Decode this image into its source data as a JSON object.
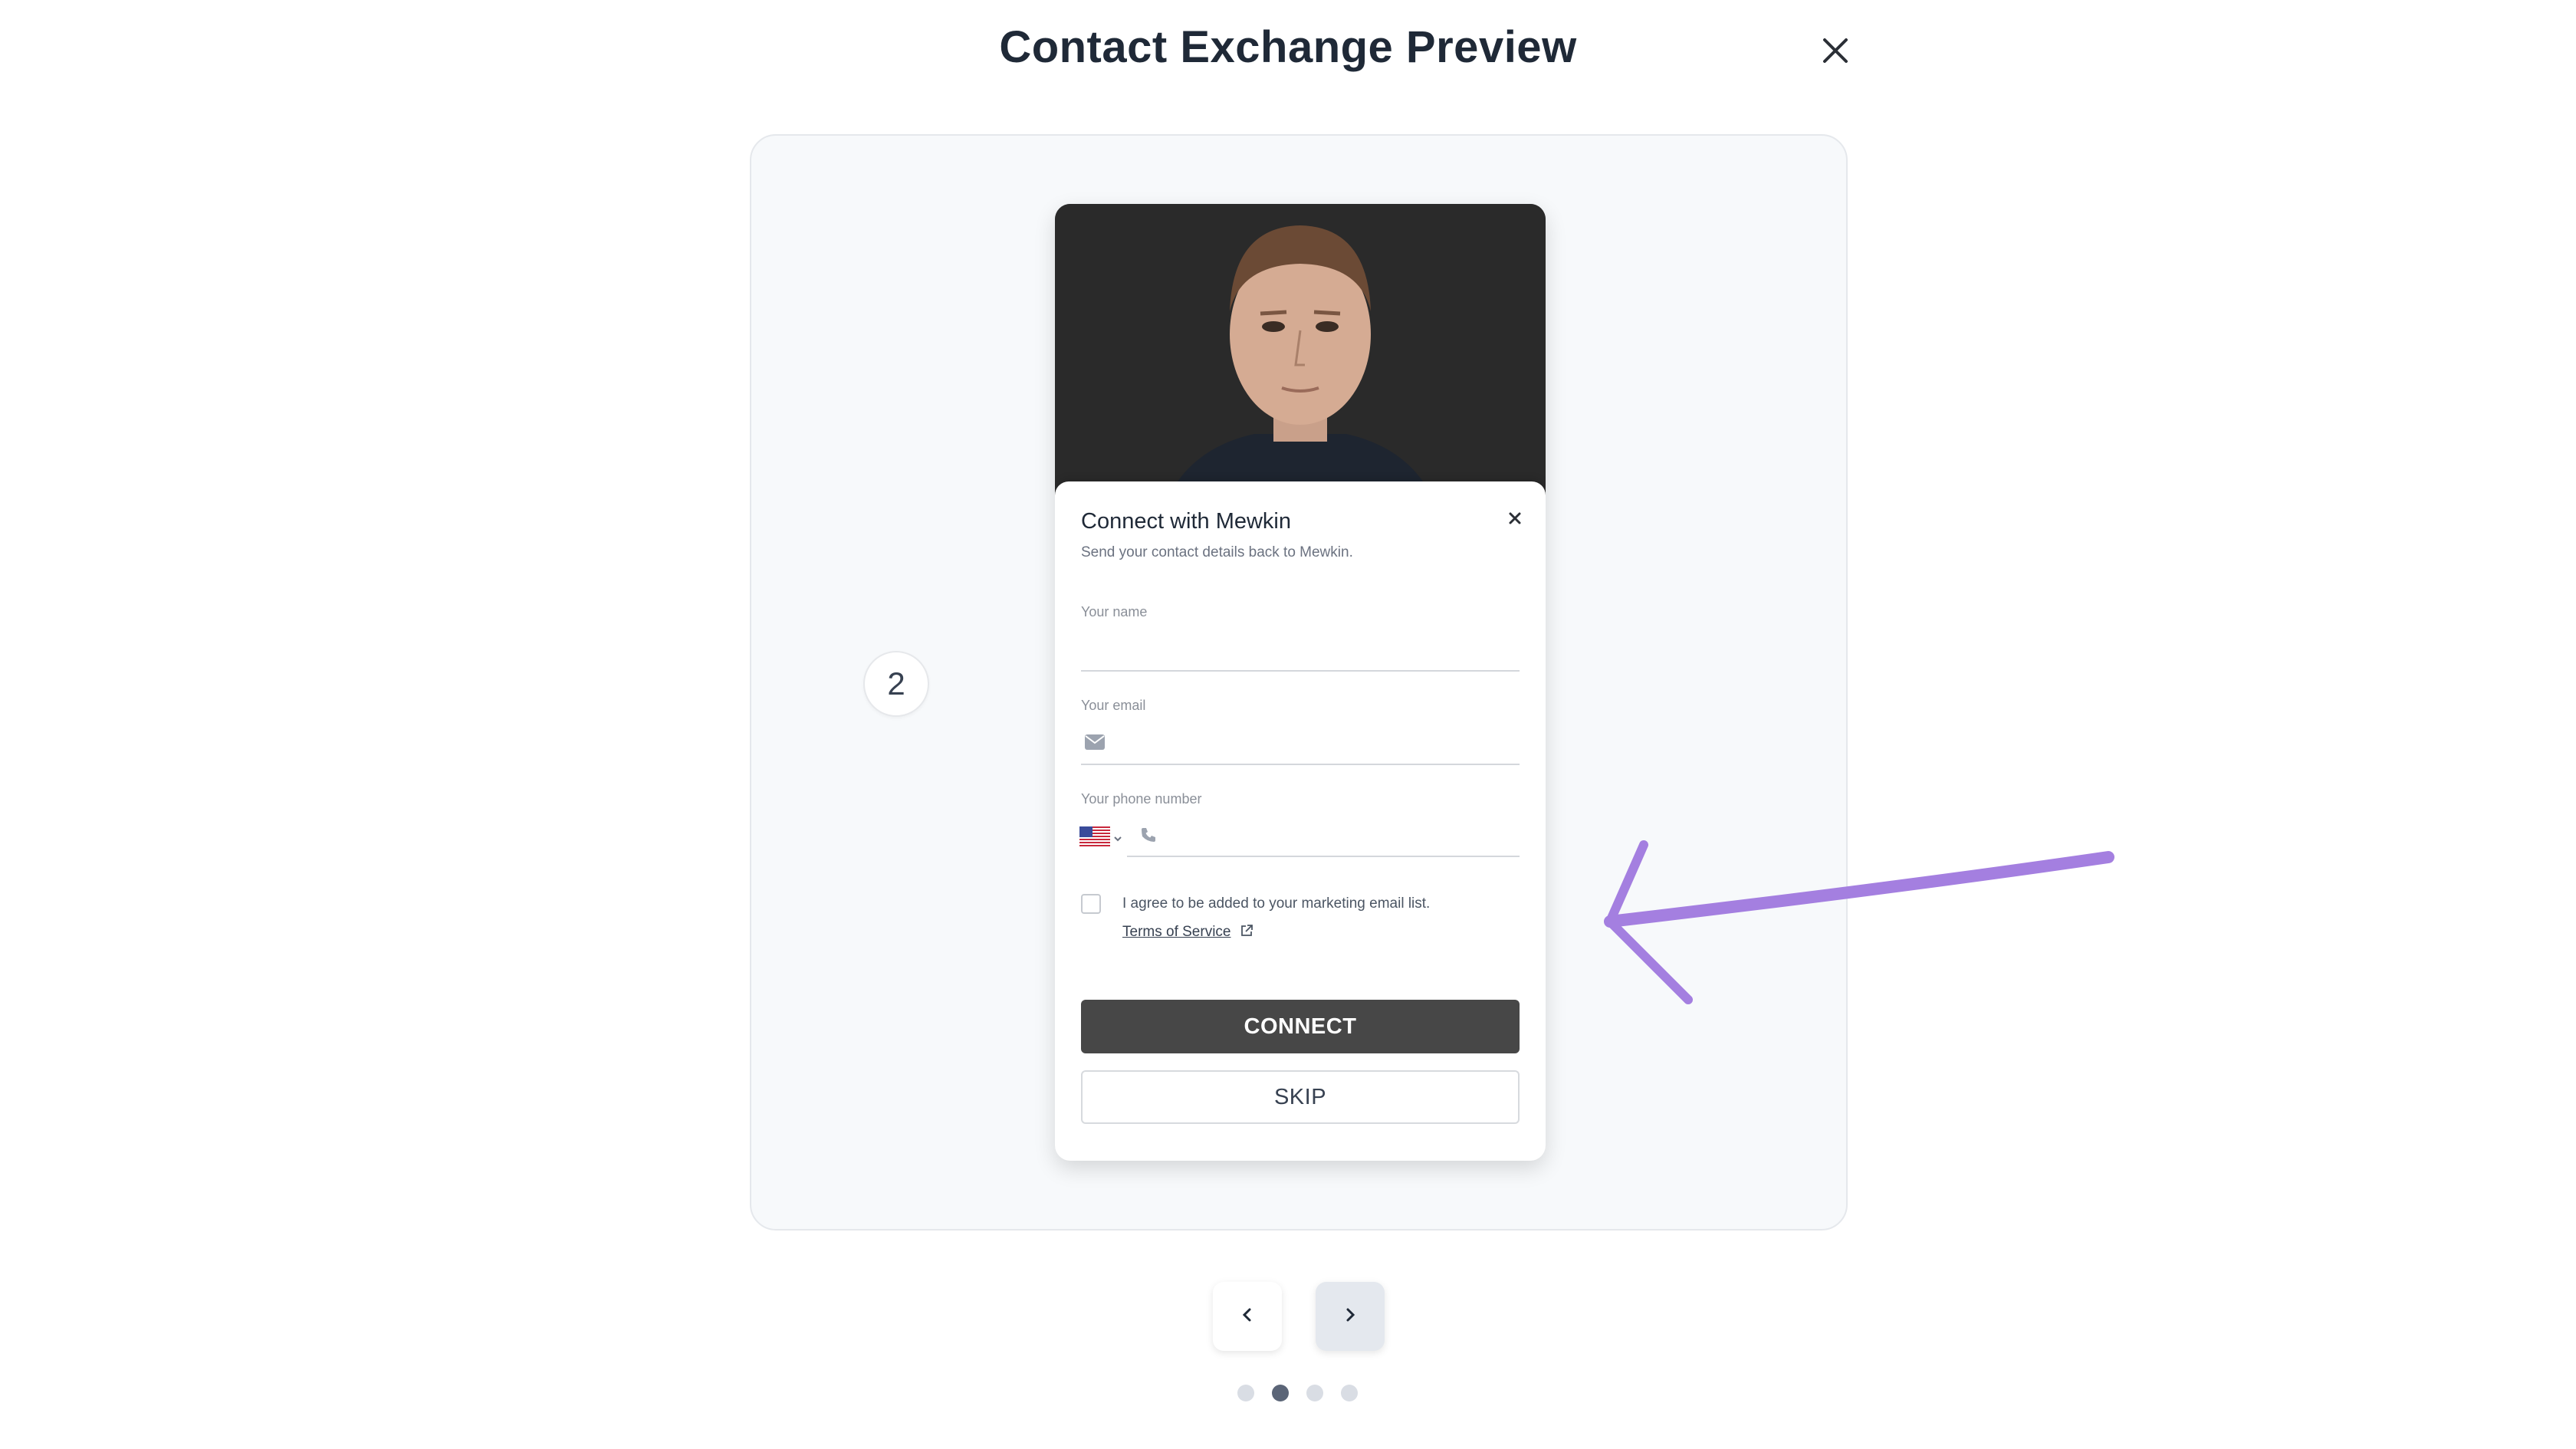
{
  "header": {
    "title": "Contact Exchange Preview",
    "close_icon": "close-icon"
  },
  "preview": {
    "step_number": "2",
    "connect_sheet": {
      "title": "Connect with Mewkin",
      "subtitle": "Send your contact details back to Mewkin.",
      "close_icon": "close-icon",
      "name_label": "Your name",
      "name_value": "",
      "email_label": "Your email",
      "email_value": "",
      "email_icon": "mail-icon",
      "phone_label": "Your phone number",
      "phone_value": "",
      "phone_country_icon": "us-flag-icon",
      "phone_icon": "phone-icon",
      "consent_text": "I agree to be added to your marketing email list.",
      "consent_checked": false,
      "terms_link": "Terms of Service",
      "terms_icon": "external-link-icon",
      "connect_button": "CONNECT",
      "skip_button": "SKIP"
    }
  },
  "pagination": {
    "prev_icon": "chevron-left-icon",
    "next_icon": "chevron-right-icon",
    "total_pages": 4,
    "active_page": 2
  },
  "colors": {
    "accent_arrow": "#a47fe0",
    "connect_button": "#474747",
    "active_dot": "#5b6577",
    "inactive_dot": "#d9dde4"
  }
}
